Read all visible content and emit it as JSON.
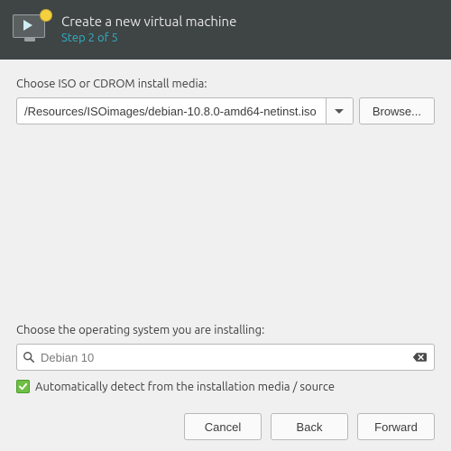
{
  "header": {
    "title": "Create a new virtual machine",
    "subtitle": "Step 2 of 5"
  },
  "media_label": "Choose ISO or CDROM install media:",
  "media": {
    "path": "/Resources/ISOimages/debian-10.8.0-amd64-netinst.iso",
    "browse_label": "Browse..."
  },
  "os_label": "Choose the operating system you are installing:",
  "os_search": {
    "value": "Debian 10"
  },
  "autodetect": {
    "checked": true,
    "label": "Automatically detect from the installation media / source"
  },
  "buttons": {
    "cancel": "Cancel",
    "back": "Back",
    "forward": "Forward"
  }
}
